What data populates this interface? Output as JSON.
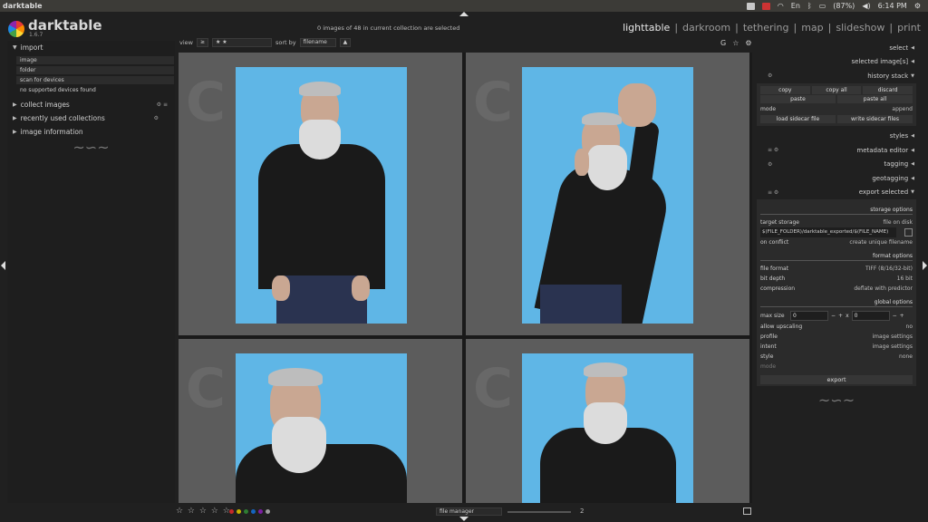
{
  "system_bar": {
    "app_name": "darktable",
    "battery": "(87%)",
    "time": "6:14 PM",
    "lang": "En"
  },
  "header": {
    "logo_text": "darktable",
    "version": "1.6.7",
    "collection_info": "0 images of 48 in current collection are selected",
    "views": [
      "lighttable",
      "darkroom",
      "tethering",
      "map",
      "slideshow",
      "print"
    ],
    "separator": "|"
  },
  "left_panel": {
    "import_label": "import",
    "import_buttons": [
      "image",
      "folder",
      "scan for devices"
    ],
    "no_devices": "no supported devices found",
    "sections": [
      {
        "label": "collect images"
      },
      {
        "label": "recently used collections"
      },
      {
        "label": "image information"
      }
    ],
    "squiggle": "~∽~"
  },
  "toolbar": {
    "view_label": "view",
    "view_op": "≥",
    "view_value": "★ ★",
    "sort_label": "sort by",
    "sort_value": "filename",
    "sort_dir": "▲",
    "icons": [
      "G",
      "☆",
      "⚙"
    ]
  },
  "grid": {
    "watermark": "C",
    "cells": 4
  },
  "bottom_bar": {
    "stars": "☆ ☆ ☆ ☆ ☆",
    "color_labels": [
      "#c62828",
      "#c6b400",
      "#2e7d32",
      "#1565c0",
      "#7b1fa2",
      "#9e9e9e"
    ],
    "layout": "file manager",
    "zoom": "2"
  },
  "right_panel": {
    "select": "select",
    "selected_images": "selected image[s]",
    "history_stack": "history stack",
    "history_buttons": [
      [
        "copy",
        "copy all",
        "discard"
      ],
      [
        "paste",
        "paste all"
      ]
    ],
    "mode_label": "mode",
    "mode_value": "append",
    "sidecar_buttons": [
      "load sidecar file",
      "write sidecar files"
    ],
    "styles": "styles",
    "metadata_editor": "metadata editor",
    "tagging": "tagging",
    "geotagging": "geotagging",
    "export_selected": "export selected",
    "storage_options": "storage options",
    "target_storage_label": "target storage",
    "target_storage_value": "file on disk",
    "path_value": "$(FILE_FOLDER)/darktable_exported/$(FILE_NAME)",
    "on_conflict_label": "on conflict",
    "on_conflict_value": "create unique filename",
    "format_options": "format options",
    "file_format_label": "file format",
    "file_format_value": "TIFF (8/16/32-bit)",
    "bit_depth_label": "bit depth",
    "bit_depth_value": "16 bit",
    "compression_label": "compression",
    "compression_value": "deflate with predictor",
    "global_options": "global options",
    "max_size_label": "max size",
    "max_w": "0",
    "max_h": "0",
    "x": "x",
    "allow_upscaling_label": "allow upscaling",
    "allow_upscaling_value": "no",
    "profile_label": "profile",
    "profile_value": "image settings",
    "intent_label": "intent",
    "intent_value": "image settings",
    "style_label": "style",
    "style_value": "none",
    "mode2_label": "mode",
    "export_button": "export"
  }
}
